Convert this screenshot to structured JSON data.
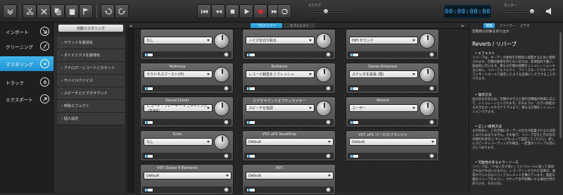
{
  "toolbar": {
    "volume_label": "スクラブ",
    "monitor_label": "モニター",
    "timecode": "00:00:00:00"
  },
  "left_nav": {
    "items": [
      {
        "label": "インポート",
        "icon": "import-icon"
      },
      {
        "label": "クリーニング",
        "icon": "brush-icon"
      },
      {
        "label": "マスタリング",
        "icon": "disc-icon"
      },
      {
        "label": "トラック",
        "icon": "track-icon"
      },
      {
        "label": "エクスポート",
        "icon": "export-icon"
      }
    ],
    "active": "マスタリング"
  },
  "category_panel": {
    "auto_button": "自動マスタリング",
    "items": [
      "サウンドを最適化",
      "ダイナミクスを最適化",
      "アナログ・レコードとカセット",
      "モバイルデバイス",
      "スピーチとビデオサウンド",
      "特殊エフェクト",
      "個人設定"
    ]
  },
  "main_tabs": {
    "project": "プロジェクト",
    "object": "オブジェクト",
    "collapse_left": "«",
    "collapse_right": "»"
  },
  "cards": [
    {
      "title": "",
      "value": "なし",
      "knob": true
    },
    {
      "title": "",
      "value": "ノイズを切り取る",
      "knob": true
    },
    {
      "title": "",
      "value": "HiFi サウンド",
      "knob": true
    },
    {
      "title": "Multimax",
      "value": "ラウドネスブースト(中)",
      "knob": true
    },
    {
      "title": "Brilliance",
      "value": "レコード録音をリフレッシュ",
      "knob": true
    },
    {
      "title": "Stereo Enhancer",
      "value": "ステレオを拡張 (弱)",
      "knob": true
    },
    {
      "title": "Sound Cloner",
      "value": "レコード・プレーヤー:イコライジング（RIAA）",
      "knob": true
    },
    {
      "title": "ビデオサウンドオプティマイザー",
      "value": "スピーチを強調",
      "knob": true
    },
    {
      "title": "Reverb",
      "value": "ユーザー",
      "knob": true
    },
    {
      "title": "Echo",
      "value": "なし",
      "knob": true
    },
    {
      "title": "VST: eFX VocalStrip",
      "value": "Default",
      "knob": false
    },
    {
      "title": "VST: eFX コーラス/フランジャ",
      "value": "Default",
      "knob": false
    },
    {
      "title": "VST: Ozone 9 Elements",
      "value": "Default",
      "knob": false
    },
    {
      "title": "VST:",
      "value": "Default",
      "knob": false
    }
  ],
  "right_panel": {
    "tabs": [
      "情報",
      "ファイラー",
      "ビデオ"
    ],
    "active_tab": "情報",
    "subtitle": "空間的な印象を作り出す",
    "heading": "Reverb / リバーブ",
    "sections": [
      {
        "title": "エフェクト",
        "text": "リバーブは、オーディオ素材を空間的に配置するために使用されます。空間的要素を持たない信号は、非現実的で重い、耐弱的に欠けます。異なる空間の残響をシミュレーションするために、リバーブエフェクト、フリーズモードでホールやコンサートホールで録音したような音源にしたりすることができます。"
      },
      {
        "title": "操作方法",
        "text": "出力信号の長さは、空間の大きさと壁の音響面の性質に応じて、シミュレーションされます。そのように、小さい部屋から大きなホールやカテドラルまで、異なる空間をシミュレーションできます。"
      },
      {
        "title": "正しい使用方法",
        "text": "まず初めに、どの空間にオーディオ信号が配置されるか決定しなければなりません。その後で、リバーブ信号と元の信号の間の比率を[ミキシング]によって設定してください。新しいスピーチレコーディングの場合、一定量のリバーブも常にひとつあります。"
      },
      {
        "title": "可能性のあるエラーソース",
        "text": "リバーブは、「少ない方が良い」というルールに従って追加されなければいけません。レコーディングされた音楽は、通常すでに十分なリバーブエレメントを備えています。過度な量のリバーブをエコー、ウケンテ音不明瞭にする場合が然りあります。それに対し"
      }
    ]
  }
}
